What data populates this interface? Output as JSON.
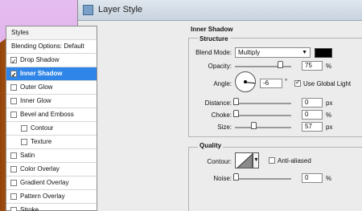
{
  "window": {
    "title": "Layer Style"
  },
  "styles_panel": {
    "header": "Styles",
    "items": [
      {
        "label": "Blending Options: Default",
        "checkbox": false
      },
      {
        "label": "Drop Shadow",
        "checkbox": true,
        "checked": true
      },
      {
        "label": "Inner Shadow",
        "checkbox": true,
        "checked": true,
        "selected": true
      },
      {
        "label": "Outer Glow",
        "checkbox": true,
        "checked": false
      },
      {
        "label": "Inner Glow",
        "checkbox": true,
        "checked": false
      },
      {
        "label": "Bevel and Emboss",
        "checkbox": true,
        "checked": false
      },
      {
        "label": "Contour",
        "checkbox": true,
        "checked": false,
        "indent": true
      },
      {
        "label": "Texture",
        "checkbox": true,
        "checked": false,
        "indent": true
      },
      {
        "label": "Satin",
        "checkbox": true,
        "checked": false
      },
      {
        "label": "Color Overlay",
        "checkbox": true,
        "checked": false
      },
      {
        "label": "Gradient Overlay",
        "checkbox": true,
        "checked": false
      },
      {
        "label": "Pattern Overlay",
        "checkbox": true,
        "checked": false
      },
      {
        "label": "Stroke",
        "checkbox": true,
        "checked": false
      }
    ]
  },
  "inner_shadow": {
    "title": "Inner Shadow",
    "structure": {
      "title": "Structure",
      "blend_mode_label": "Blend Mode:",
      "blend_mode_value": "Multiply",
      "color": "#000000",
      "opacity_label": "Opacity:",
      "opacity_value": "75",
      "opacity_unit": "%",
      "angle_label": "Angle:",
      "angle_value": "-6",
      "angle_unit": "°",
      "global_light_label": "Use Global Light",
      "global_light_checked": true,
      "distance_label": "Distance:",
      "distance_value": "0",
      "distance_unit": "px",
      "choke_label": "Choke:",
      "choke_value": "0",
      "choke_unit": "%",
      "size_label": "Size:",
      "size_value": "57",
      "size_unit": "px"
    },
    "quality": {
      "title": "Quality",
      "contour_label": "Contour:",
      "anti_aliased_label": "Anti-aliased",
      "anti_aliased_checked": false,
      "noise_label": "Noise:",
      "noise_value": "0",
      "noise_unit": "%"
    }
  }
}
